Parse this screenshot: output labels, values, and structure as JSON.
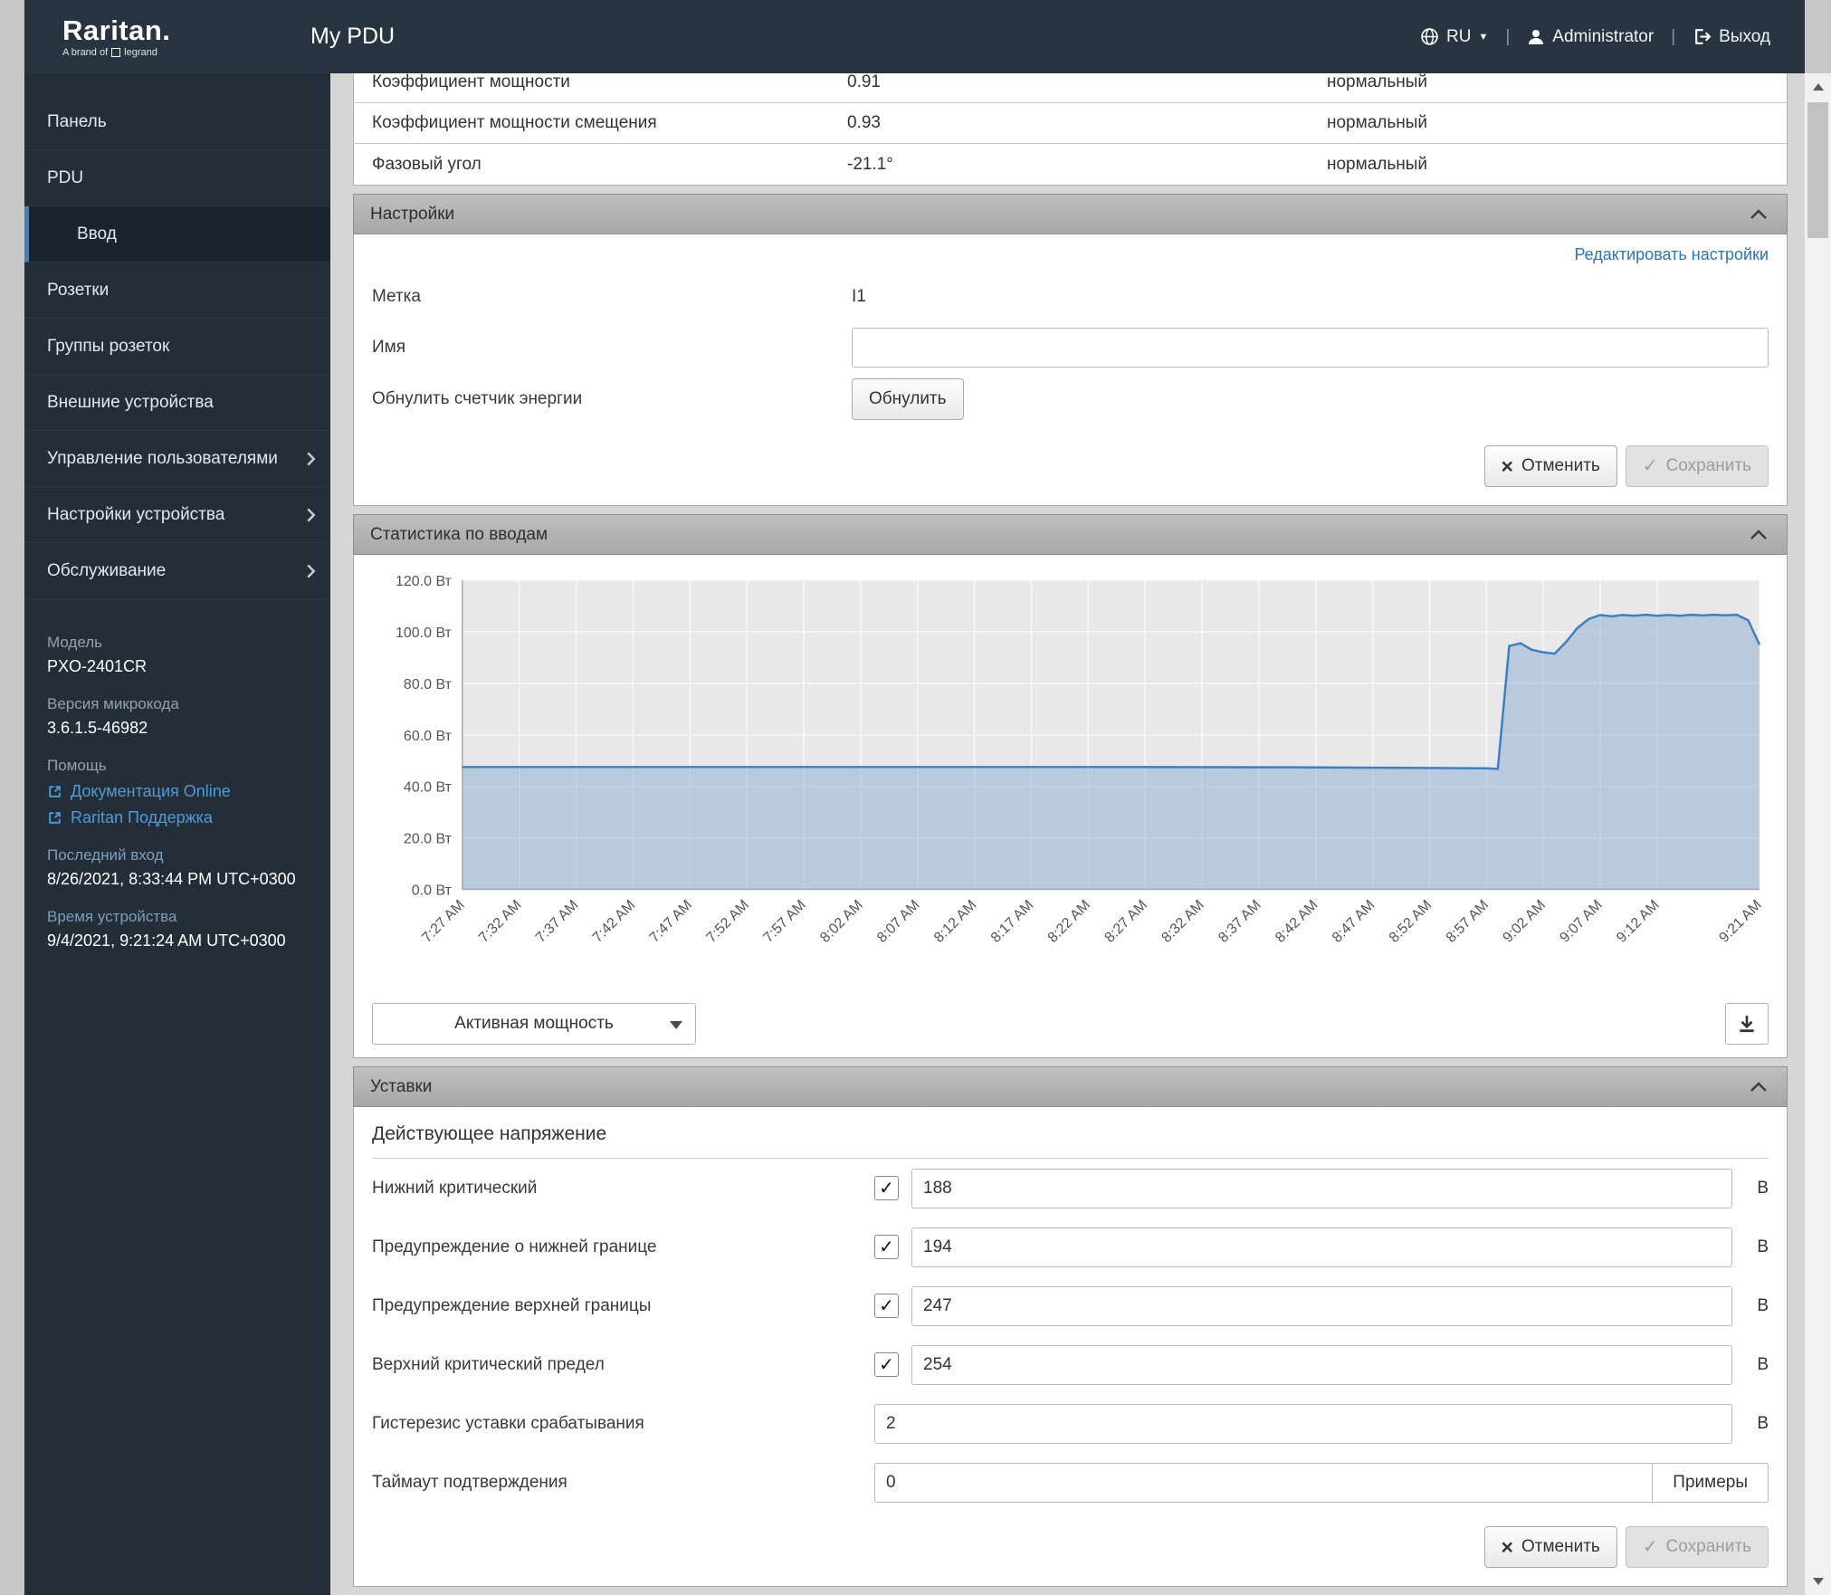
{
  "header": {
    "brand": "Raritan.",
    "brand_sub_prefix": "A brand of",
    "brand_sub_name": "legrand",
    "title": "My PDU",
    "lang": "RU",
    "user": "Administrator",
    "logout": "Выход",
    "sep": "|"
  },
  "sidebar": {
    "items": [
      {
        "label": "Панель"
      },
      {
        "label": "PDU"
      },
      {
        "label": "Ввод",
        "active": true
      },
      {
        "label": "Розетки"
      },
      {
        "label": "Группы розеток"
      },
      {
        "label": "Внешние устройства"
      },
      {
        "label": "Управление пользователями",
        "expandable": true
      },
      {
        "label": "Настройки устройства",
        "expandable": true
      },
      {
        "label": "Обслуживание",
        "expandable": true
      }
    ],
    "info": {
      "model_label": "Модель",
      "model_value": "PXO-2401CR",
      "firmware_label": "Версия микрокода",
      "firmware_value": "3.6.1.5-46982",
      "help_label": "Помощь",
      "link_docs": "Документация Online",
      "link_support": "Raritan Поддержка",
      "last_login_label": "Последний вход",
      "last_login_value": "8/26/2021, 8:33:44 PM UTC+0300",
      "device_time_label": "Время устройства",
      "device_time_value": "9/4/2021, 9:21:24 AM UTC+0300"
    }
  },
  "sensor_table": {
    "rows": [
      {
        "name": "Коэффициент мощности",
        "value": "0.91",
        "status": "нормальный"
      },
      {
        "name": "Коэффициент мощности смещения",
        "value": "0.93",
        "status": "нормальный"
      },
      {
        "name": "Фазовый угол",
        "value": "-21.1°",
        "status": "нормальный"
      }
    ]
  },
  "settings": {
    "title": "Настройки",
    "edit_link": "Редактировать настройки",
    "label_label": "Метка",
    "label_value": "I1",
    "name_label": "Имя",
    "name_value": "",
    "reset_label": "Обнулить счетчик энергии",
    "reset_button": "Обнулить"
  },
  "actions": {
    "cancel": "Отменить",
    "save": "Сохранить"
  },
  "stats": {
    "title": "Статистика по вводам",
    "selector": "Активная мощность"
  },
  "chart_data": {
    "type": "area",
    "title": "Статистика по вводам",
    "series_name": "Активная мощность",
    "ylabel": "Вт",
    "ylim": [
      0,
      120
    ],
    "grid": true,
    "plot_bg": "#e8e8e8",
    "grid_color": "#f7f7f7",
    "axis_color": "#ababab",
    "line_color": "#3e7fc1",
    "fill_color": "rgba(128,166,208,0.45)",
    "x_start": "7:27",
    "x_end": "9:21",
    "yticks": [
      {
        "v": 120,
        "label": "120.0 Вт"
      },
      {
        "v": 100,
        "label": "100.0 Вт"
      },
      {
        "v": 80,
        "label": "80.0 Вт"
      },
      {
        "v": 60,
        "label": "60.0 Вт"
      },
      {
        "v": 40,
        "label": "40.0 Вт"
      },
      {
        "v": 20,
        "label": "20.0 Вт"
      },
      {
        "v": 0,
        "label": "0.0 Вт"
      }
    ],
    "xticks": [
      "7:27 AM",
      "7:32 AM",
      "7:37 AM",
      "7:42 AM",
      "7:47 AM",
      "7:52 AM",
      "7:57 AM",
      "8:02 AM",
      "8:07 AM",
      "8:12 AM",
      "8:17 AM",
      "8:22 AM",
      "8:27 AM",
      "8:32 AM",
      "8:37 AM",
      "8:42 AM",
      "8:47 AM",
      "8:52 AM",
      "8:57 AM",
      "9:02 AM",
      "9:07 AM",
      "9:12 AM",
      "9:21 AM"
    ],
    "series": [
      {
        "name": "Активная мощность",
        "points": [
          [
            "7:27",
            47.5
          ],
          [
            "7:40",
            47.5
          ],
          [
            "8:00",
            47.5
          ],
          [
            "8:20",
            47.5
          ],
          [
            "8:40",
            47.4
          ],
          [
            "8:50",
            47.2
          ],
          [
            "8:57",
            47.0
          ],
          [
            "8:58",
            46.8
          ],
          [
            "8:59",
            94.5
          ],
          [
            "9:00",
            95.5
          ],
          [
            "9:01",
            93.0
          ],
          [
            "9:02",
            92.0
          ],
          [
            "9:03",
            91.5
          ],
          [
            "9:04",
            96.0
          ],
          [
            "9:05",
            101.5
          ],
          [
            "9:06",
            105.0
          ],
          [
            "9:07",
            106.5
          ],
          [
            "9:08",
            106.0
          ],
          [
            "9:09",
            106.5
          ],
          [
            "9:10",
            106.2
          ],
          [
            "9:11",
            106.6
          ],
          [
            "9:12",
            106.2
          ],
          [
            "9:13",
            106.5
          ],
          [
            "9:14",
            106.2
          ],
          [
            "9:15",
            106.6
          ],
          [
            "9:16",
            106.3
          ],
          [
            "9:17",
            106.6
          ],
          [
            "9:18",
            106.4
          ],
          [
            "9:19",
            106.6
          ],
          [
            "9:20",
            104.5
          ],
          [
            "9:21",
            95.0
          ]
        ]
      }
    ]
  },
  "thresholds": {
    "title": "Уставки",
    "subtitle": "Действующее напряжение",
    "rows": [
      {
        "label": "Нижний критический",
        "checked": true,
        "value": "188",
        "unit": "В"
      },
      {
        "label": "Предупреждение о нижней границе",
        "checked": true,
        "value": "194",
        "unit": "В"
      },
      {
        "label": "Предупреждение верхней границы",
        "checked": true,
        "value": "247",
        "unit": "В"
      },
      {
        "label": "Верхний критический предел",
        "checked": true,
        "value": "254",
        "unit": "В"
      },
      {
        "label": "Гистерезис уставки срабатывания",
        "checked": false,
        "value": "2",
        "unit": "В"
      },
      {
        "label": "Таймаут подтверждения",
        "checked": false,
        "value": "0",
        "button": "Примеры"
      }
    ]
  }
}
